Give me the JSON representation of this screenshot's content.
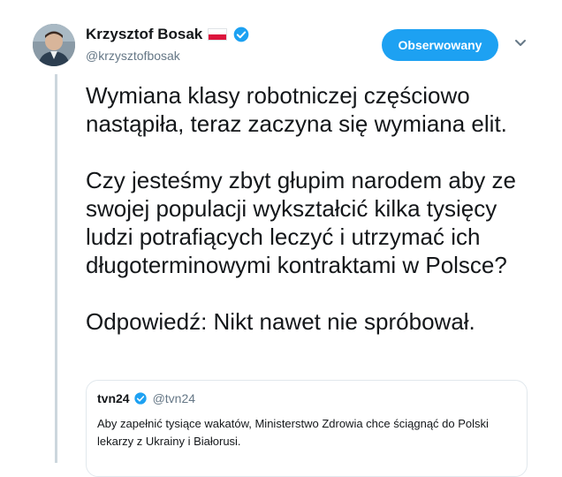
{
  "tweet": {
    "author_name": "Krzysztof Bosak",
    "author_handle": "@krzysztofbosak",
    "follow_label": "Obserwowany",
    "text": "Wymiana klasy robotniczej częściowo nastąpiła, teraz zaczyna się wymiana elit.\n\nCzy jesteśmy zbyt głupim narodem aby ze swojej populacji wykształcić kilka tysięcy ludzi potrafiących leczyć i utrzymać ich długoterminowymi kontraktami w Polsce?\n\nOdpowiedź: Nikt nawet nie spróbował."
  },
  "quote": {
    "author_name": "tvn24",
    "author_handle": "@tvn24",
    "text": "Aby zapełnić tysiące wakatów, Ministerstwo Zdrowia chce ściągnąć do Polski lekarzy z Ukrainy i Białorusi."
  },
  "icons": {
    "verified": "verified-badge-icon",
    "flag": "poland-flag-icon",
    "menu": "chevron-down-icon"
  },
  "colors": {
    "accent": "#1da1f2",
    "text": "#14171a",
    "secondary_text": "#657786",
    "border": "#e1e8ed"
  }
}
